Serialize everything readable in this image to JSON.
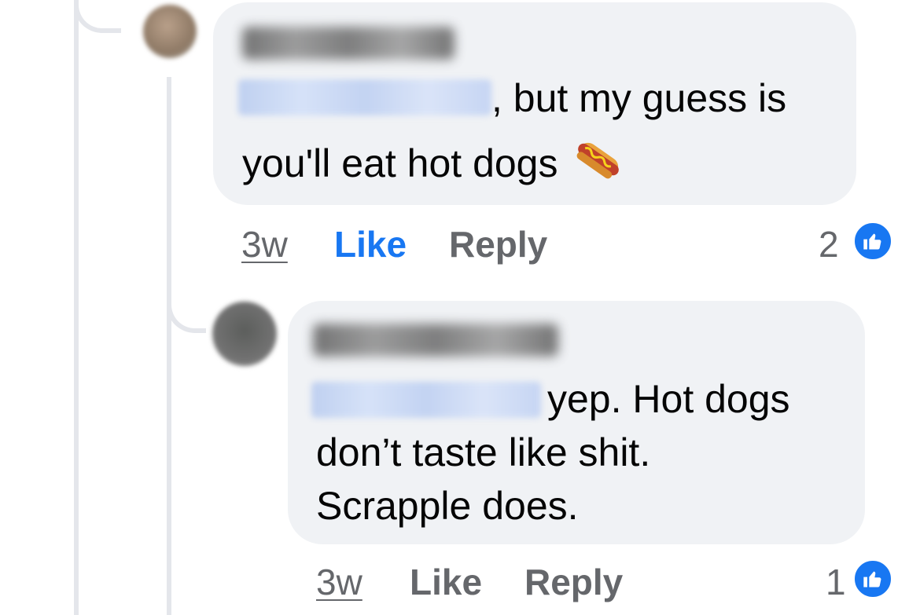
{
  "comments": [
    {
      "text_after_mention": ", but my guess is",
      "text_line2": "you'll eat hot dogs",
      "emoji": "hotdog-icon",
      "time": "3w",
      "like_label": "Like",
      "reply_label": "Reply",
      "like_count": "2",
      "liked": true
    },
    {
      "text_after_mention": "yep.  Hot dogs",
      "text_line2": "don’t taste like shit.",
      "text_line3": "Scrapple does.",
      "time": "3w",
      "like_label": "Like",
      "reply_label": "Reply",
      "like_count": "1",
      "liked": false
    }
  ],
  "colors": {
    "accent": "#1877f2",
    "bubble": "#f0f2f5",
    "meta": "#65676b",
    "thread": "#e4e6eb"
  }
}
